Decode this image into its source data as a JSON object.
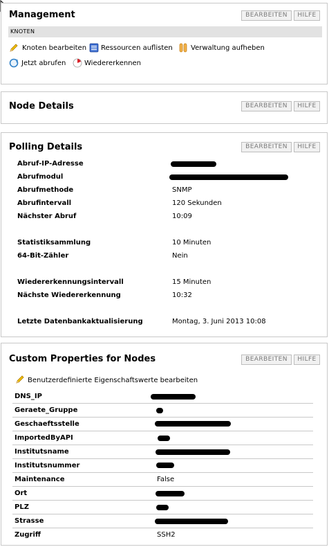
{
  "management": {
    "title": "Management",
    "edit_label": "BEARBEITEN",
    "help_label": "HILFE",
    "section_header": "KNOTEN",
    "actions": [
      {
        "label": "Knoten bearbeiten",
        "icon": "pencil-icon"
      },
      {
        "label": "Ressourcen auflisten",
        "icon": "list-icon"
      },
      {
        "label": "Verwaltung aufheben",
        "icon": "pause-icon"
      },
      {
        "label": "Jetzt abrufen",
        "icon": "refresh-icon"
      },
      {
        "label": "Wiedererkennen",
        "icon": "rediscover-icon"
      }
    ]
  },
  "node_details": {
    "title": "Node Details",
    "edit_label": "BEARBEITEN",
    "help_label": "HILFE"
  },
  "polling": {
    "title": "Polling Details",
    "edit_label": "BEARBEITEN",
    "help_label": "HILFE",
    "rows": [
      {
        "label": "Abruf-IP-Adresse",
        "value": ""
      },
      {
        "label": "Abrufmodul",
        "value": ""
      },
      {
        "label": "Abrufmethode",
        "value": "SNMP"
      },
      {
        "label": "Abrufintervall",
        "value": "120 Sekunden"
      },
      {
        "label": "Nächster Abruf",
        "value": "10:09"
      },
      {
        "label": "Statistiksammlung",
        "value": "10 Minuten"
      },
      {
        "label": "64-Bit-Zähler",
        "value": "Nein"
      },
      {
        "label": "Wiedererkennungsintervall",
        "value": "15 Minuten"
      },
      {
        "label": "Nächste Wiedererkennung",
        "value": "10:32"
      },
      {
        "label": "Letzte Datenbankaktualisierung",
        "value": "Montag, 3. Juni 2013 10:08"
      }
    ]
  },
  "custom_props": {
    "title": "Custom Properties for Nodes",
    "edit_label": "BEARBEITEN",
    "help_label": "HILFE",
    "edit_link": "Benutzerdefinierte Eigenschaftswerte bearbeiten",
    "rows": [
      {
        "label": "DNS_IP",
        "value": ""
      },
      {
        "label": "Geraete_Gruppe",
        "value": ""
      },
      {
        "label": "Geschaeftsstelle",
        "value": ""
      },
      {
        "label": "ImportedByAPI",
        "value": ""
      },
      {
        "label": "Institutsname",
        "value": ""
      },
      {
        "label": "Institutsnummer",
        "value": ""
      },
      {
        "label": "Maintenance",
        "value": "False"
      },
      {
        "label": "Ort",
        "value": ""
      },
      {
        "label": "PLZ",
        "value": ""
      },
      {
        "label": "Strasse",
        "value": ""
      },
      {
        "label": "Zugriff",
        "value": "SSH2"
      }
    ]
  },
  "colors": {
    "panel_border": "#c8c8c8",
    "section_header_bg": "#e2e2e2",
    "button_bg": "#f1f1f1",
    "button_text": "#7a7a7a",
    "redaction": "#000000"
  }
}
